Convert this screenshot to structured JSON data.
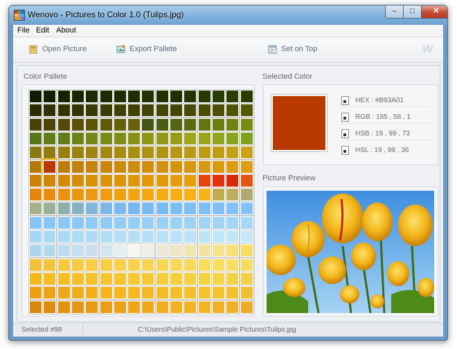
{
  "window": {
    "title": "Wenovo - Pictures to Color 1.0 (Tulips.jpg)",
    "controls": {
      "minimize": "‒",
      "maximize": "□",
      "close": "✕"
    }
  },
  "menu": [
    {
      "label": "File"
    },
    {
      "label": "Edit"
    },
    {
      "label": "About"
    }
  ],
  "toolbar": {
    "open_picture": "Open Picture",
    "export_pallete": "Export Pallete",
    "set_on_top": "Set on Top",
    "logo": "W"
  },
  "palette": {
    "title": "Color Pallete",
    "selected_index": 98,
    "colors": [
      [
        "#111c00",
        "#132000",
        "#172200",
        "#192600",
        "#1b2a00",
        "#1d2a00",
        "#1f2c00",
        "#1f2e00",
        "#213200",
        "#213000",
        "#1f3000",
        "#233400",
        "#253800",
        "#273c00",
        "#293e00",
        "#2a3e00"
      ],
      [
        "#2b2b04",
        "#2e3204",
        "#323402",
        "#343602",
        "#383a02",
        "#3c3c02",
        "#3e4004",
        "#3f4202",
        "#414402",
        "#434602",
        "#454604",
        "#474a04",
        "#4a4c04",
        "#4b5004",
        "#4e5404",
        "#525805"
      ],
      [
        "#4a4108",
        "#4e4408",
        "#524a08",
        "#5a5008",
        "#5e5408",
        "#62580a",
        "#66600a",
        "#6a620a",
        "#445414",
        "#4c5c14",
        "#546414",
        "#5c6a12",
        "#647410",
        "#6c7c10",
        "#708210",
        "#788c12"
      ],
      [
        "#577818",
        "#5f7f16",
        "#637d18",
        "#6b8218",
        "#738618",
        "#7b8a16",
        "#818e16",
        "#8a9216",
        "#8e9614",
        "#94981a",
        "#9a9c18",
        "#a0a41a",
        "#9ca41c",
        "#90a61c",
        "#86a41e",
        "#7ea21c"
      ],
      [
        "#8a7a10",
        "#907c10",
        "#967e10",
        "#9a8210",
        "#9e8612",
        "#a28810",
        "#a68c12",
        "#aa8e12",
        "#ae9212",
        "#b29412",
        "#b69614",
        "#ba9a14",
        "#bc9c14",
        "#c09e14",
        "#c4a016",
        "#c8a416"
      ],
      [
        "#b3780a",
        "#b93a01",
        "#be7c0a",
        "#c2800c",
        "#c6840c",
        "#c8860c",
        "#cc8a0c",
        "#ce8c0e",
        "#d08e0e",
        "#d2920e",
        "#d4940e",
        "#d69610",
        "#d89810",
        "#da9a10",
        "#dc9c12",
        "#de9e12"
      ],
      [
        "#cb8305",
        "#cf8705",
        "#d38b07",
        "#d58d07",
        "#d79107",
        "#d99307",
        "#db9509",
        "#dd9709",
        "#df9909",
        "#e19b09",
        "#e39d0b",
        "#e59f0b",
        "#e5440b",
        "#e3330b",
        "#d82a0a",
        "#e0560d"
      ],
      [
        "#e7850b",
        "#e78f0d",
        "#e9930d",
        "#eb970d",
        "#ed990f",
        "#ef9d0f",
        "#efa10f",
        "#f1a511",
        "#f3a711",
        "#f3ab11",
        "#f5af13",
        "#f7b113",
        "#f7b315",
        "#c3ac50",
        "#bcae5c",
        "#b0aa72"
      ],
      [
        "#a4b38a",
        "#98b19a",
        "#8eb0ac",
        "#84b4c4",
        "#80b6d8",
        "#7cb8e6",
        "#7ab8ee",
        "#78b8f2",
        "#78baf4",
        "#78bcf6",
        "#7abef6",
        "#7cbef6",
        "#7ec0f6",
        "#80c0f6",
        "#82c2f6",
        "#84c2f6"
      ],
      [
        "#86c4f6",
        "#88c6f6",
        "#8ac6f6",
        "#8cc8f6",
        "#8ecaf6",
        "#90caf6",
        "#92ccf6",
        "#94cef6",
        "#96cef6",
        "#98d0f6",
        "#9ad2f6",
        "#9cd2f6",
        "#9ed4f6",
        "#a0d4f6",
        "#a2d6f6",
        "#a4d8f6"
      ],
      [
        "#a6d8f6",
        "#a8daf6",
        "#aadaf6",
        "#acdcf6",
        "#aedcf6",
        "#b0def6",
        "#b2def6",
        "#b4e0f6",
        "#b6e0f6",
        "#b8e2f6",
        "#bae2f6",
        "#bce4f6",
        "#bee4f6",
        "#c0e6f6",
        "#c2e6f6",
        "#c4e8f6"
      ],
      [
        "#b0d4ea",
        "#b4d8ee",
        "#bcdcf0",
        "#c4e0f2",
        "#ccdef0",
        "#d4e4f0",
        "#e4eeee",
        "#f6f6ee",
        "#eeeee6",
        "#ece8d6",
        "#eee6c4",
        "#f0e6b4",
        "#f2e4a0",
        "#f4e28c",
        "#f6e078",
        "#f8de64"
      ],
      [
        "#f2c236",
        "#f4c43a",
        "#f6c83e",
        "#f8ca42",
        "#f8cc44",
        "#f8ce46",
        "#f8d04a",
        "#f8d24c",
        "#f8d450",
        "#f8d652",
        "#f8d856",
        "#f8da5a",
        "#f8dc5c",
        "#f8de60",
        "#f8de64",
        "#f6dc60"
      ],
      [
        "#f4b81c",
        "#f6bc20",
        "#f6be22",
        "#f6c026",
        "#f6c228",
        "#f6c42c",
        "#f6c62e",
        "#f6c832",
        "#f6ca34",
        "#f6cc38",
        "#f6ce3a",
        "#f6d03e",
        "#f6d240",
        "#f6d444",
        "#f4d246",
        "#f2d048"
      ],
      [
        "#eba013",
        "#eda415",
        "#efa817",
        "#f1ac19",
        "#f3b01b",
        "#f5b41d",
        "#f5b61f",
        "#f5b821",
        "#f5ba23",
        "#f5bc25",
        "#f5be27",
        "#f5c029",
        "#f5c22b",
        "#f3c22d",
        "#f1c02f",
        "#efbe31"
      ],
      [
        "#d9880c",
        "#dd8c0e",
        "#e19210",
        "#e59612",
        "#e79a14",
        "#e99e16",
        "#eba218",
        "#eda61a",
        "#efaa1c",
        "#f1ae1e",
        "#f3b220",
        "#f3b422",
        "#f1b424",
        "#efb226",
        "#edb028",
        "#ebae2a"
      ]
    ]
  },
  "selected_color": {
    "title": "Selected Color",
    "hex": "#B93A01",
    "hex_text": "HEX : #B93A01",
    "rgb_text": "RGB : 185 , 58 , 1",
    "hsb_text": "HSB : 19 , 99 , 73",
    "hsl_text": "HSL : 19 , 99 , 36"
  },
  "preview": {
    "title": "Picture Preview"
  },
  "status": {
    "selected": "Selected #98",
    "path": "C:\\Users\\Public\\Pictures\\Sample Pictures\\Tulips.jpg"
  }
}
